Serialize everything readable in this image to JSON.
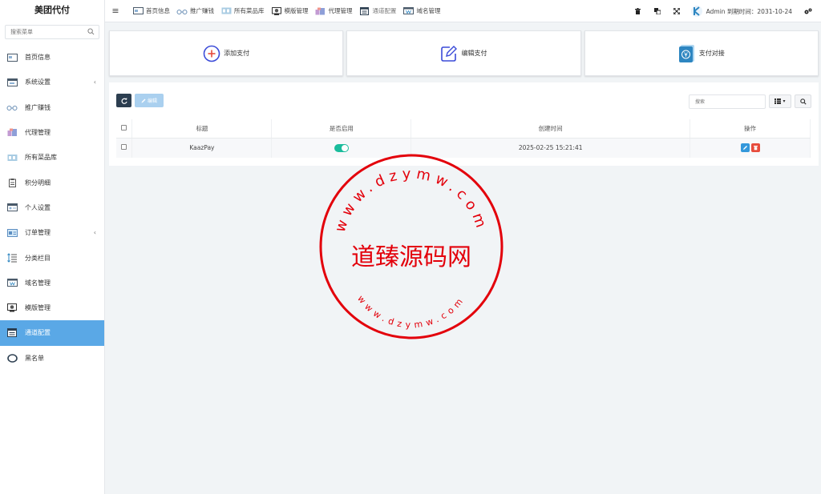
{
  "sidebar": {
    "brand": "美团代付",
    "search_placeholder": "搜索菜单",
    "items": [
      {
        "label": "首页信息",
        "icon": "home-card-icon",
        "caret": ""
      },
      {
        "label": "系统设置",
        "icon": "settings-card-icon",
        "caret": "‹"
      },
      {
        "label": "推广赚钱",
        "icon": "glasses-icon",
        "caret": ""
      },
      {
        "label": "代理管理",
        "icon": "agent-icon",
        "caret": ""
      },
      {
        "label": "所有菜品库",
        "icon": "dishes-icon",
        "caret": ""
      },
      {
        "label": "积分明细",
        "icon": "document-icon",
        "caret": ""
      },
      {
        "label": "个人设置",
        "icon": "profile-card-icon",
        "caret": ""
      },
      {
        "label": "订单管理",
        "icon": "order-icon",
        "caret": "‹"
      },
      {
        "label": "分类栏目",
        "icon": "category-icon",
        "caret": ""
      },
      {
        "label": "域名管理",
        "icon": "domain-icon",
        "caret": ""
      },
      {
        "label": "模版管理",
        "icon": "template-icon",
        "caret": ""
      },
      {
        "label": "通道配置",
        "icon": "channel-icon",
        "caret": ""
      },
      {
        "label": "黑名单",
        "icon": "blacklist-icon",
        "caret": ""
      }
    ],
    "active_index": 11
  },
  "topbar": {
    "nav": [
      {
        "label": "首页信息",
        "icon": "home-card-icon"
      },
      {
        "label": "推广赚钱",
        "icon": "glasses-icon"
      },
      {
        "label": "所有菜品库",
        "icon": "dishes-icon"
      },
      {
        "label": "模版管理",
        "icon": "template-icon"
      },
      {
        "label": "代理管理",
        "icon": "agent-icon"
      },
      {
        "label": "通道配置",
        "icon": "channel-icon"
      },
      {
        "label": "域名管理",
        "icon": "domain-icon"
      }
    ],
    "admin_text": "Admin 到期时间：2031-10-24"
  },
  "cards": [
    {
      "label": "添加支付",
      "icon": "plus-circle-icon"
    },
    {
      "label": "编辑支付",
      "icon": "edit-square-icon"
    },
    {
      "label": "支付对接",
      "icon": "yuan-icon"
    }
  ],
  "toolbar": {
    "edit_label": "编辑",
    "search_placeholder": "搜索"
  },
  "table": {
    "headers": [
      "标题",
      "是否启用",
      "创建时间",
      "操作"
    ],
    "rows": [
      {
        "title": "KaazPay",
        "enabled": true,
        "created": "2025-02-25 15:21:41"
      }
    ]
  },
  "watermark": {
    "center_text": "道臻源码网",
    "ring_top": "www.dzymw.com",
    "ring_bottom": "www.dzymw.com"
  },
  "colors": {
    "active": "#5aa8e6",
    "toggle": "#1abc9c",
    "stamp": "#e3000b",
    "dark_button": "#2c3e50"
  }
}
